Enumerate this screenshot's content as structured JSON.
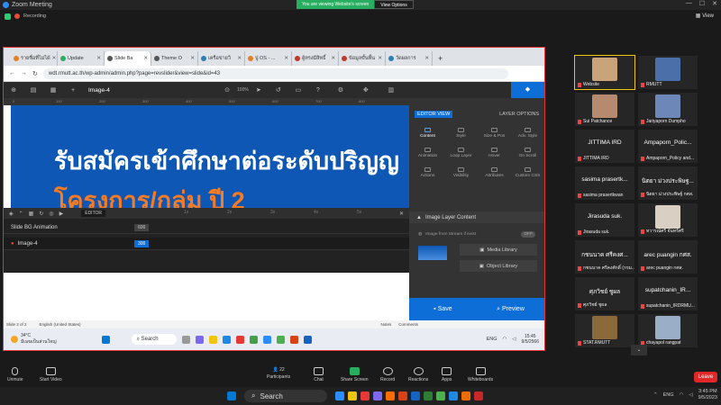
{
  "zoom": {
    "title": "Zoom Meeting",
    "banner_text": "You are viewing Website's screen",
    "view_options": "View Options",
    "recording": "Recording",
    "view": "View"
  },
  "browser": {
    "tabs": [
      {
        "label": "รายชื่อที่ไม่ได้",
        "color": "#e67e22"
      },
      {
        "label": "Update",
        "color": "#27ae60"
      },
      {
        "label": "Slide Ba",
        "color": "#555"
      },
      {
        "label": "Theme O",
        "color": "#555"
      },
      {
        "label": "เครือข่ายวิ",
        "color": "#2980b9"
      },
      {
        "label": "ปู OS - ...",
        "color": "#e67e22"
      },
      {
        "label": "ผู้ทรงมีสิทธิ์",
        "color": "#c0392b"
      },
      {
        "label": "ข้อมูลขั้นพื้น",
        "color": "#c0392b"
      },
      {
        "label": "วัดผลการ",
        "color": "#2980b9"
      }
    ],
    "new_tab": "+",
    "url": "wdt.rmutt.ac.th/wp-admin/admin.php?page=revslider&view=slide&id=43"
  },
  "revslider": {
    "layer_title": "Image-4",
    "zoom": "100%",
    "headline": "รับสมัครเข้าศึกษาต่อระดับปริญญ",
    "headline2": "โครงการ/กลุ่ม ปี 2",
    "timeline": {
      "editor": "EDITOR",
      "rows": [
        {
          "name": "Slide BG Animation",
          "value": "600"
        },
        {
          "name": "Image-4",
          "value": "300"
        }
      ],
      "ticks": [
        "1s",
        "2s",
        "3s",
        "4s",
        "5s"
      ]
    },
    "panel": {
      "editor_view": "EDITOR VIEW",
      "layer_options": "LAYER OPTIONS",
      "options": [
        "Content",
        "Style",
        "Size & Pos",
        "Adv. Style",
        "Animation",
        "Loop Layer",
        "Hover",
        "On Scroll",
        "Actions",
        "Visibility",
        "Attributes",
        "Custom CSS"
      ],
      "image_layer_content": "Image Layer Content",
      "stream": "Image from Stream if exist",
      "stream_switch": "OFF",
      "media_library": "Media Library",
      "object_library": "Object Library",
      "save": "Save",
      "preview": "Preview"
    }
  },
  "statusbar": {
    "slide": "Slide 2 of 2",
    "lang": "English (United States)",
    "notes": "Notes",
    "comments": "Comments"
  },
  "inner_taskbar": {
    "temp": "34°C",
    "weather": "มีเมฆเป็นส่วนใหญ่",
    "search": "Search",
    "lang": "ENG",
    "time": "15:45",
    "date": "9/5/2566"
  },
  "participants": [
    {
      "name": "Website",
      "label": ""
    },
    {
      "name": "RMUTT",
      "label": ""
    },
    {
      "name": "Sui Patchance",
      "label": ""
    },
    {
      "name": "Jariyaporn Dumpho",
      "label": ""
    },
    {
      "name": "JITTIMA IRD",
      "label": "JITTIMA IRD"
    },
    {
      "name": "Ampaporn_Policy and...",
      "label": "Ampaporn_Polic..."
    },
    {
      "name": "sasima prasertkwan",
      "label": "sasima prasertk..."
    },
    {
      "name": "นิตยา ม่วงประพิษฐ์ กศส.",
      "label": "นิตยา ม่วงประพิษฐ..."
    },
    {
      "name": "Jirasuda suk.",
      "label": "Jirasuda suk."
    },
    {
      "name": "ทวารณ์ศรี จันทร์ศรี",
      "label": ""
    },
    {
      "name": "กชนนาค ศรีคงศักดิ์ (กรม...)",
      "label": "กชนนาค ศรีคงศ..."
    },
    {
      "name": "arec puangin กศส.",
      "label": "arec puangin กศส."
    },
    {
      "name": "ศุภวิชย์ ชูผล",
      "label": "ศุภวิชย์ ชูผล"
    },
    {
      "name": "supatchanin_IRDRMU...",
      "label": "supatchanin_IR..."
    },
    {
      "name": "STAT.RMUTT",
      "label": ""
    },
    {
      "name": "chayapol rangpat",
      "label": ""
    }
  ],
  "toolbar": {
    "unmute": "Unmute",
    "start_video": "Start Video",
    "participants": "Participants",
    "participants_count": "22",
    "chat": "Chat",
    "share": "Share Screen",
    "record": "Record",
    "reactions": "Reactions",
    "apps": "Apps",
    "whiteboards": "Whiteboards",
    "leave": "Leave"
  },
  "win_taskbar": {
    "search": "Search",
    "lang": "ENG",
    "time": "3:45 PM",
    "date": "9/5/2023"
  }
}
